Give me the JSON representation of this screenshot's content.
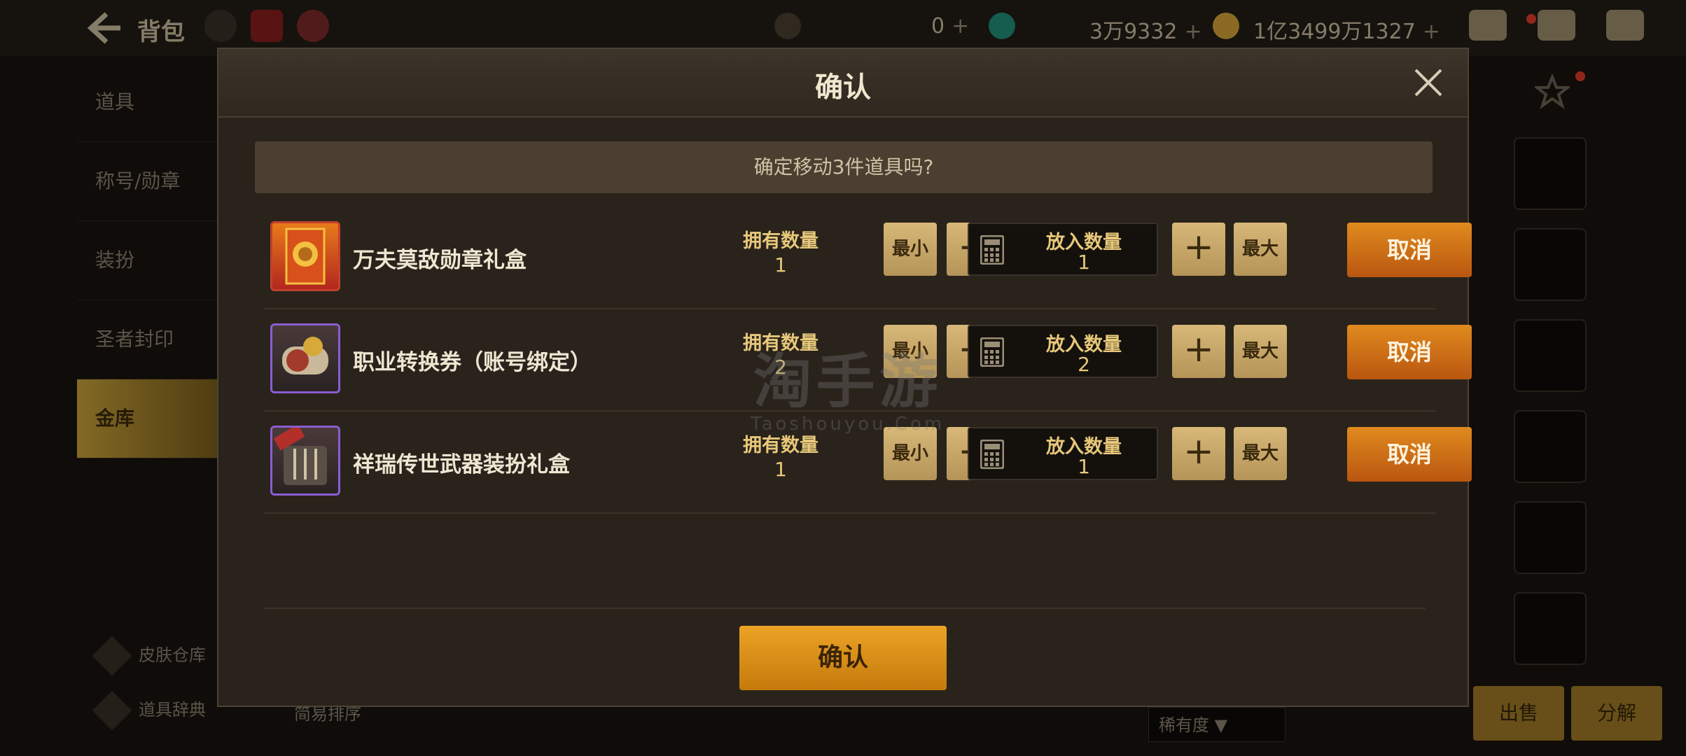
{
  "background": {
    "bag_title": "背包",
    "currency_1": "0",
    "currency_2": "3万9332",
    "currency_3": "1亿3499万1327",
    "plus": "+",
    "sidebar_items": [
      "道具",
      "称号/勋章",
      "装扮",
      "圣者封印",
      "金库"
    ],
    "skin_storage": "皮肤仓库",
    "item_dictionary": "道具辞典",
    "sort_label": "简易排序",
    "rarity_label": "稀有度",
    "sell_label": "出售",
    "disassemble_label": "分解"
  },
  "dialog": {
    "title": "确认",
    "prompt": "确定移动3件道具吗?",
    "owned_label": "拥有数量",
    "put_label": "放入数量",
    "min_label": "最小",
    "max_label": "最大",
    "minus": "−",
    "plus": "+",
    "cancel_label": "取消",
    "confirm_label": "确认",
    "items": [
      {
        "name": "万夫莫敌勋章礼盒",
        "owned": "1",
        "put": "1",
        "icon": "medal-box-icon"
      },
      {
        "name": "职业转换券（账号绑定）",
        "owned": "2",
        "put": "2",
        "icon": "job-ticket-icon"
      },
      {
        "name": "祥瑞传世武器装扮礼盒",
        "owned": "1",
        "put": "1",
        "icon": "weapon-box-icon"
      }
    ]
  },
  "watermark": {
    "big": "淘手游",
    "small": "Taoshouyou.Com"
  },
  "colors": {
    "accent_gold": "#e7c87a",
    "cancel_orange": "#d9781a",
    "confirm_gold": "#e29a1e"
  }
}
